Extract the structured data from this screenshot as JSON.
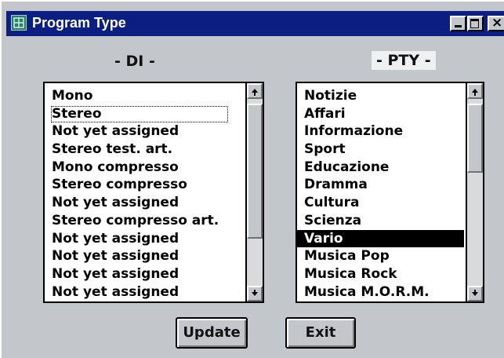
{
  "window": {
    "title": "Program Type",
    "controls": {
      "minimize_icon": "minimize-icon",
      "maximize_icon": "maximize-icon",
      "close_icon": "close-icon",
      "close_glyph": "×"
    }
  },
  "di": {
    "heading": "- DI -",
    "items": [
      "Mono",
      "Stereo",
      "Not yet assigned",
      "Stereo test. art.",
      "Mono compresso",
      "Stereo compresso",
      "Not yet assigned",
      "Stereo compresso art.",
      "Not yet assigned",
      "Not yet assigned",
      "Not yet assigned",
      "Not yet assigned"
    ],
    "focused_item": "Stereo"
  },
  "pty": {
    "heading": "- PTY -",
    "items": [
      "Notizie",
      "Affari",
      "Informazione",
      "Sport",
      "Educazione",
      "Dramma",
      "Cultura",
      "Scienza",
      "Vario",
      "Musica Pop",
      "Musica Rock",
      "Musica M.O.R.M."
    ],
    "selected_item": "Vario"
  },
  "buttons": {
    "update": "Update",
    "exit": "Exit"
  },
  "colors": {
    "titlebar": "#0b1f83",
    "face": "#c3c7cb",
    "selection": "#000000"
  }
}
